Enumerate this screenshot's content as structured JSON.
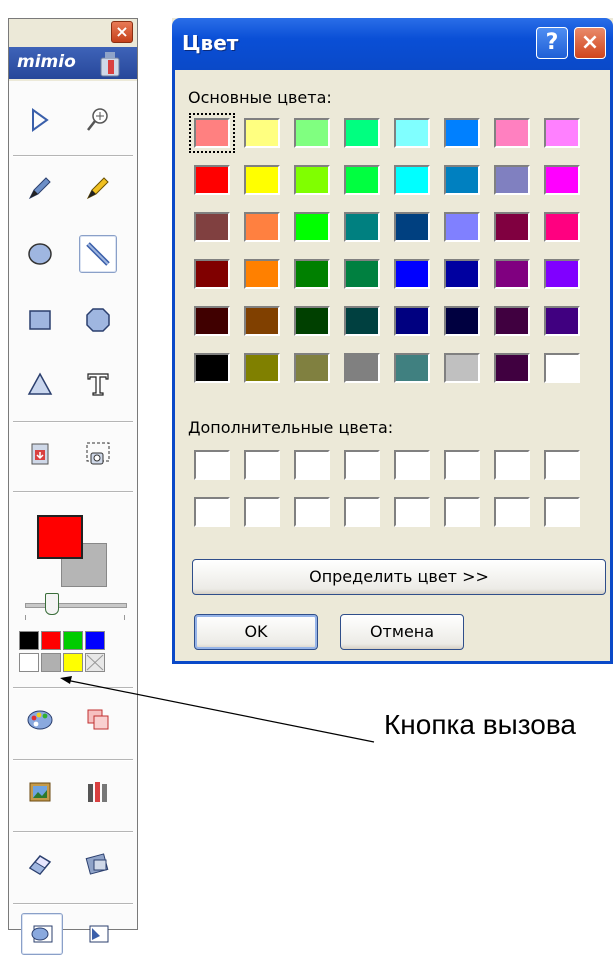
{
  "toolbar": {
    "logo_text": "mimio",
    "close_glyph": "×",
    "tools": [
      {
        "name": "select-arrow-icon"
      },
      {
        "name": "zoom-icon"
      },
      {
        "name": "pen-icon"
      },
      {
        "name": "highlighter-icon"
      },
      {
        "name": "ellipse-icon"
      },
      {
        "name": "line-icon"
      },
      {
        "name": "rectangle-icon"
      },
      {
        "name": "octagon-icon"
      },
      {
        "name": "triangle-icon"
      },
      {
        "name": "text-tool-icon"
      },
      {
        "name": "insert-image-icon"
      },
      {
        "name": "screen-capture-icon"
      }
    ],
    "fill_color": "#ff0000",
    "outline_color": "#b5b5b5",
    "palette": [
      "#000000",
      "#ff0000",
      "#00cc00",
      "#0000ff",
      "#ffffff",
      "#b0b0b0",
      "#ffff00",
      "#e8e8e8"
    ],
    "bottom_tools": [
      {
        "name": "color-palette-icon"
      },
      {
        "name": "layers-icon"
      },
      {
        "name": "gallery-image-icon"
      },
      {
        "name": "tools-kit-icon"
      },
      {
        "name": "eraser-icon"
      },
      {
        "name": "clear-page-icon"
      },
      {
        "name": "edit-mode-icon"
      },
      {
        "name": "select-mode-icon"
      }
    ]
  },
  "dialog": {
    "title": "Цвет",
    "help_glyph": "?",
    "close_glyph": "×",
    "basic_colors_label": "Основные цвета:",
    "basic_colors": [
      [
        "#ff8080",
        "#ffff80",
        "#80ff80",
        "#00ff80",
        "#80ffff",
        "#0080ff",
        "#ff80c0",
        "#ff80ff"
      ],
      [
        "#ff0000",
        "#ffff00",
        "#80ff00",
        "#00ff40",
        "#00ffff",
        "#0080c0",
        "#8080c0",
        "#ff00ff"
      ],
      [
        "#804040",
        "#ff8040",
        "#00ff00",
        "#008080",
        "#004080",
        "#8080ff",
        "#800040",
        "#ff0080"
      ],
      [
        "#800000",
        "#ff8000",
        "#008000",
        "#008040",
        "#0000ff",
        "#0000a0",
        "#800080",
        "#8000ff"
      ],
      [
        "#400000",
        "#804000",
        "#004000",
        "#004040",
        "#000080",
        "#000040",
        "#400040",
        "#400080"
      ],
      [
        "#000000",
        "#808000",
        "#808040",
        "#808080",
        "#408080",
        "#c0c0c0",
        "#400040",
        "#ffffff"
      ]
    ],
    "custom_colors_label": "Дополнительные цвета:",
    "custom_colors": [
      [
        "#ffffff",
        "#ffffff",
        "#ffffff",
        "#ffffff",
        "#ffffff",
        "#ffffff",
        "#ffffff",
        "#ffffff"
      ],
      [
        "#ffffff",
        "#ffffff",
        "#ffffff",
        "#ffffff",
        "#ffffff",
        "#ffffff",
        "#ffffff",
        "#ffffff"
      ]
    ],
    "define_button": "Определить цвет >>",
    "ok_button": "OK",
    "cancel_button": "Отмена"
  },
  "callout": {
    "text": "Кнопка вызова"
  }
}
